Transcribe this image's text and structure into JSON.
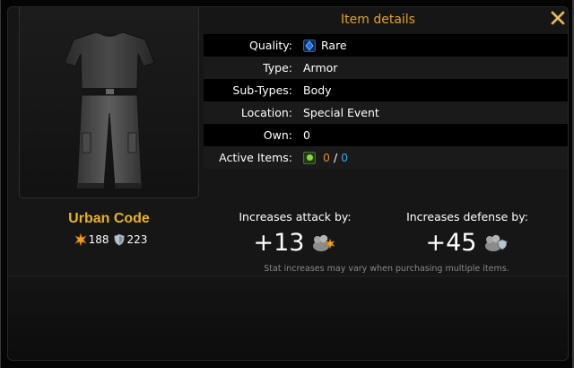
{
  "dialog": {
    "title": "Item details"
  },
  "item": {
    "name": "Urban Code",
    "attack": "188",
    "defense": "223"
  },
  "details": {
    "quality": {
      "label": "Quality:",
      "value": "Rare"
    },
    "type": {
      "label": "Type:",
      "value": "Armor"
    },
    "subtypes": {
      "label": "Sub-Types:",
      "value": "Body"
    },
    "location": {
      "label": "Location:",
      "value": "Special Event"
    },
    "own": {
      "label": "Own:",
      "value": "0"
    },
    "active": {
      "label": "Active Items:",
      "current": "0",
      "separator": "/",
      "total": "0"
    }
  },
  "increases": {
    "attack": {
      "label": "Increases attack by:",
      "value": "+13",
      "icon": "attack-mafia-icon"
    },
    "defense": {
      "label": "Increases defense by:",
      "value": "+45",
      "icon": "defense-mafia-icon"
    },
    "note": "Stat increases may vary when purchasing multiple items."
  },
  "colors": {
    "title": "#e0a228",
    "item_name": "#e8b31a",
    "orange_value": "#e08a1e",
    "blue_value": "#3aa5e0",
    "rare_gem": "#1f6fd6"
  }
}
